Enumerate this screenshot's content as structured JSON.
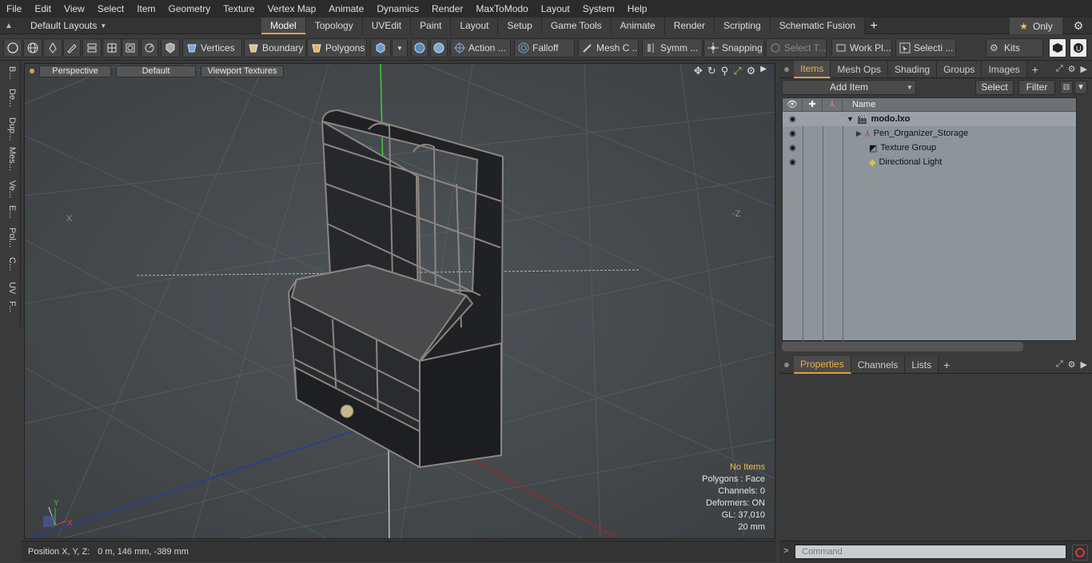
{
  "menu": [
    "File",
    "Edit",
    "View",
    "Select",
    "Item",
    "Geometry",
    "Texture",
    "Vertex Map",
    "Animate",
    "Dynamics",
    "Render",
    "MaxToModo",
    "Layout",
    "System",
    "Help"
  ],
  "layout": {
    "name": "Default Layouts"
  },
  "mode_tabs": [
    "Model",
    "Topology",
    "UVEdit",
    "Paint",
    "Layout",
    "Setup",
    "Game Tools",
    "Animate",
    "Render",
    "Scripting",
    "Schematic Fusion"
  ],
  "only_label": "Only",
  "toolbar": {
    "vertices": "Vertices",
    "boundary": "Boundary",
    "polygons": "Polygons",
    "action": "Action ...",
    "falloff": "Falloff",
    "mesh": "Mesh C ...",
    "symm": "Symm ...",
    "snapping": "Snapping",
    "select_t": "Select T...",
    "work_pl": "Work Pl...",
    "selecti": "Selecti ...",
    "kits": "Kits"
  },
  "left_strip": [
    "B...",
    "De...",
    "Dup...",
    "Mes...",
    "Ve...",
    "E...",
    "Pol...",
    "C...",
    "UV",
    "F..."
  ],
  "viewport": {
    "view": "Perspective",
    "style": "Default",
    "textures": "Viewport Textures",
    "axis_x": "X",
    "axis_z": "-Z",
    "info": {
      "no_items": "No Items",
      "polygons": "Polygons : Face",
      "channels": "Channels: 0",
      "deformers": "Deformers: ON",
      "gl": "GL: 37,010",
      "scale": "20 mm"
    },
    "gizmo_x": "X",
    "gizmo_y": "Y"
  },
  "status": {
    "label": "Position X, Y, Z:",
    "value": "0 m, 146 mm, -389 mm"
  },
  "items_panel": {
    "tabs": [
      "Items",
      "Mesh Ops",
      "Shading",
      "Groups",
      "Images"
    ],
    "add_item": "Add Item",
    "select": "Select",
    "filter": "Filter",
    "col_name": "Name",
    "rows": [
      {
        "label": "modo.lxo"
      },
      {
        "label": "Pen_Organizer_Storage"
      },
      {
        "label": "Texture Group"
      },
      {
        "label": "Directional Light"
      }
    ]
  },
  "props_panel": {
    "tabs": [
      "Properties",
      "Channels",
      "Lists"
    ]
  },
  "command": {
    "placeholder": "Command"
  }
}
